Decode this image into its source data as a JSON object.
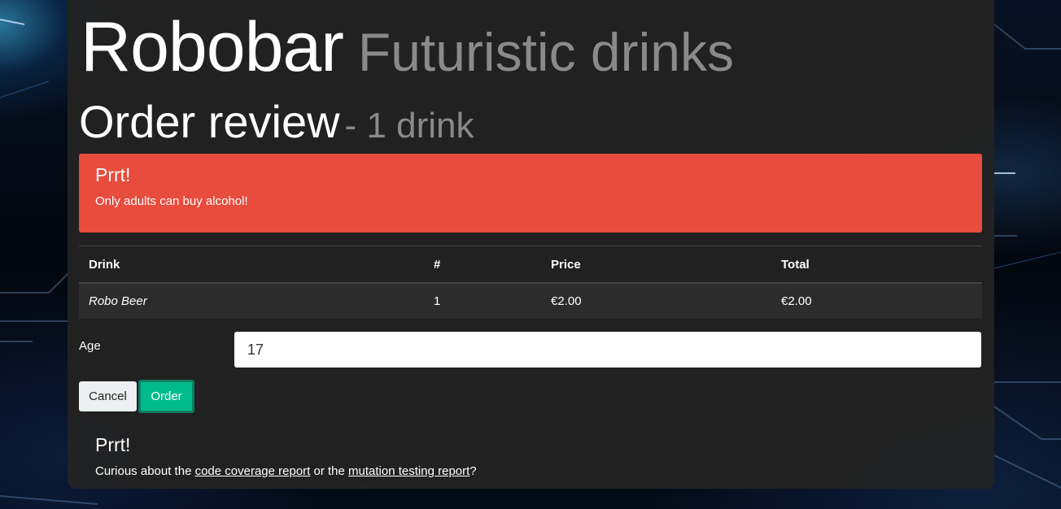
{
  "header": {
    "brand_name": "Robobar",
    "brand_tagline": "Futuristic drinks"
  },
  "review": {
    "title": "Order review",
    "subtitle": "- 1 drink"
  },
  "alert": {
    "title": "Prrt!",
    "message": "Only adults can buy alcohol!",
    "color": "#e74c3c"
  },
  "order_table": {
    "columns": [
      "Drink",
      "#",
      "Price",
      "Total"
    ],
    "rows": [
      {
        "drink": "Robo Beer",
        "quantity": "1",
        "price": "€2.00",
        "total": "€2.00"
      }
    ]
  },
  "form": {
    "age_label": "Age",
    "age_value": "17"
  },
  "buttons": {
    "cancel_label": "Cancel",
    "order_label": "Order",
    "order_color": "#00bc8c"
  },
  "footer": {
    "title": "Prrt!",
    "text_before": "Curious about the ",
    "link_coverage": "code coverage report",
    "text_middle": " or the ",
    "link_mutation": "mutation testing report",
    "text_after": "?"
  }
}
